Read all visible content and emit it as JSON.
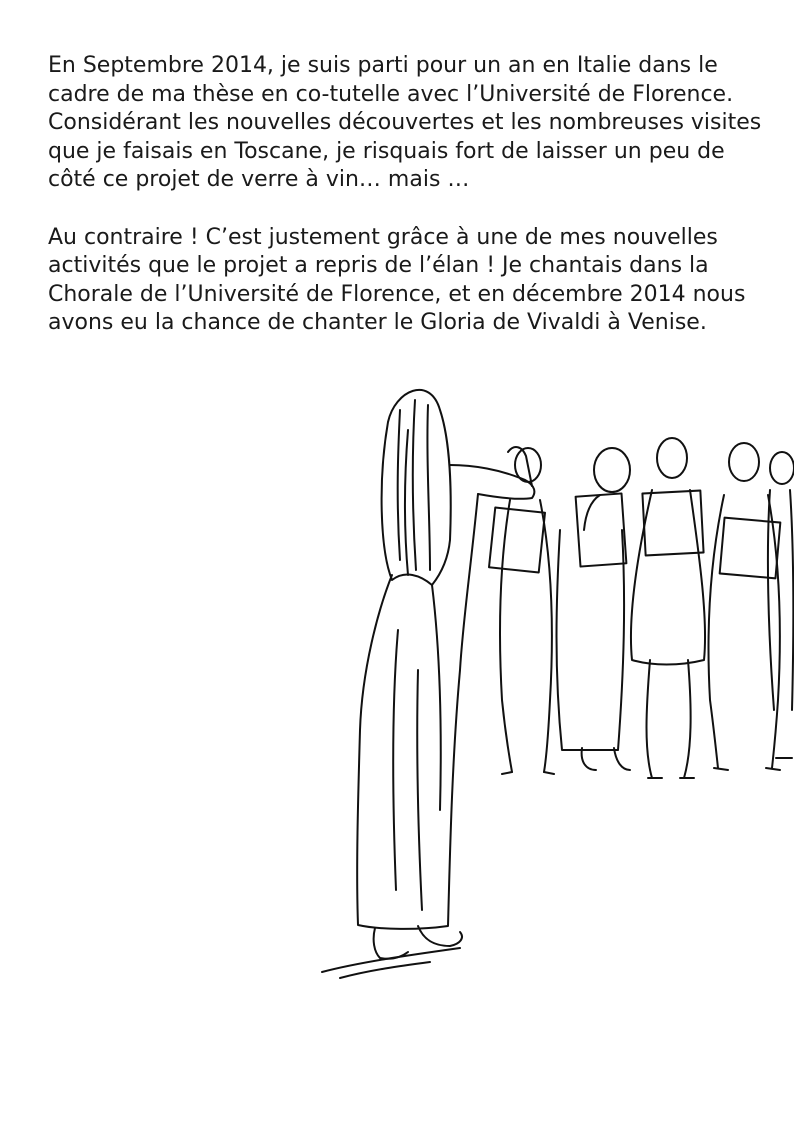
{
  "paragraphs": [
    {
      "lines": [
        "En Septembre 2014, je suis parti pour un an en Italie dans le",
        "cadre de ma thèse en co-tutelle avec l’Université de Florence.",
        "Considérant les nouvelles découvertes et les nombreuses visites",
        "que je faisais en Toscane, je risquais fort de laisser un peu de",
        "côté ce projet de verre à vin… mais …"
      ]
    },
    {
      "lines": [
        "Au contraire ! C’est justement grâce à une de mes nouvelles",
        "activités que le projet a repris de l’élan ! Je chantais dans la",
        "Chorale de l’Université de Florence, et en décembre 2014 nous",
        "avons eu la chance de chanter le Gloria de Vivaldi à Venise."
      ]
    }
  ],
  "illustration": {
    "icon": "choir-conductor-sketch"
  }
}
